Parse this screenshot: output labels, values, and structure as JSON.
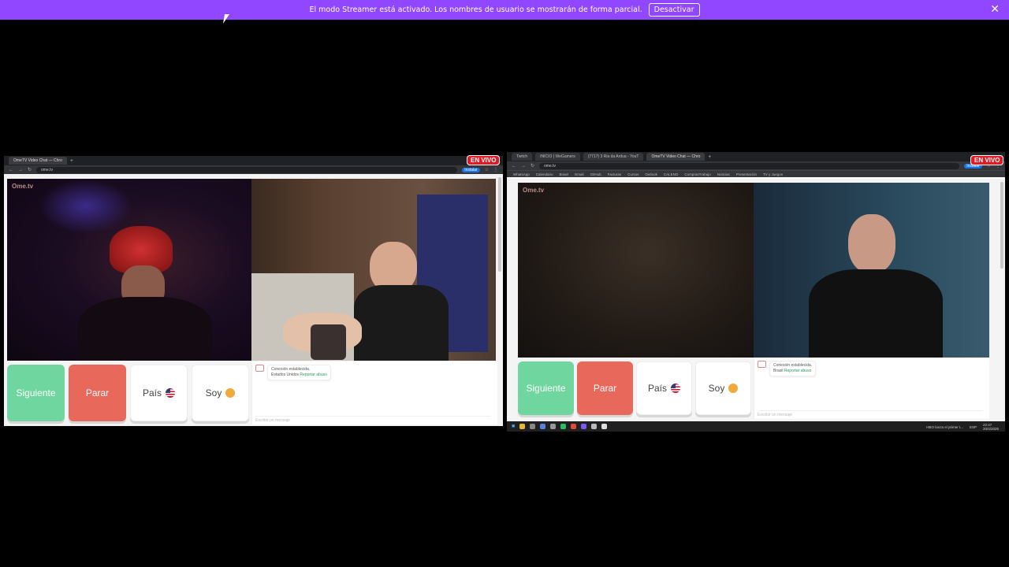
{
  "banner": {
    "message": "El modo Streamer está activado. Los nombres de usuario se mostrarán de forma parcial.",
    "button": "Desactivar",
    "color": "#9147ff"
  },
  "live_badge": "EN VIVO",
  "left_window": {
    "tabs": [
      "OmeTV Video Chat — Chro"
    ],
    "url": "ome.tv",
    "install": "Instalar",
    "logo": "Ome.tv",
    "buttons": {
      "next": "Siguiente",
      "stop": "Parar",
      "country": "País",
      "me": "Soy"
    },
    "chat": {
      "status": "Conexión establecida.",
      "country_prefix": "Estados Unidos",
      "report": "Reportar abuso",
      "placeholder": "Escribir un mensaje"
    }
  },
  "right_window": {
    "tabs": [
      "Twitch",
      "INICIO | WeGamers",
      "(7717) 3 Ria da Ardua - YouT",
      "OmeTV Video Chat — Chro"
    ],
    "url": "ome.tv",
    "install": "Instalar",
    "bookmarks": [
      "WhatsApp",
      "Calendario",
      "Brawl",
      "Gmail",
      "GitHub",
      "Facturas",
      "Cursos",
      "Outlook",
      "CALENO",
      "ComprasTrabajo",
      "Noticias",
      "Presentación",
      "TV y Juegos"
    ],
    "logo": "Ome.tv",
    "buttons": {
      "next": "Siguiente",
      "stop": "Parar",
      "country": "País",
      "me": "Soy"
    },
    "chat": {
      "status": "Conexión establecida.",
      "country_prefix": "Brasil",
      "report": "Reportar abuso",
      "placeholder": "Escribir un mensaje"
    },
    "taskbar": {
      "notification": "HBO lanza el primer t...",
      "lang": "ESP",
      "time": "22:47",
      "date": "20/4/2026"
    }
  }
}
